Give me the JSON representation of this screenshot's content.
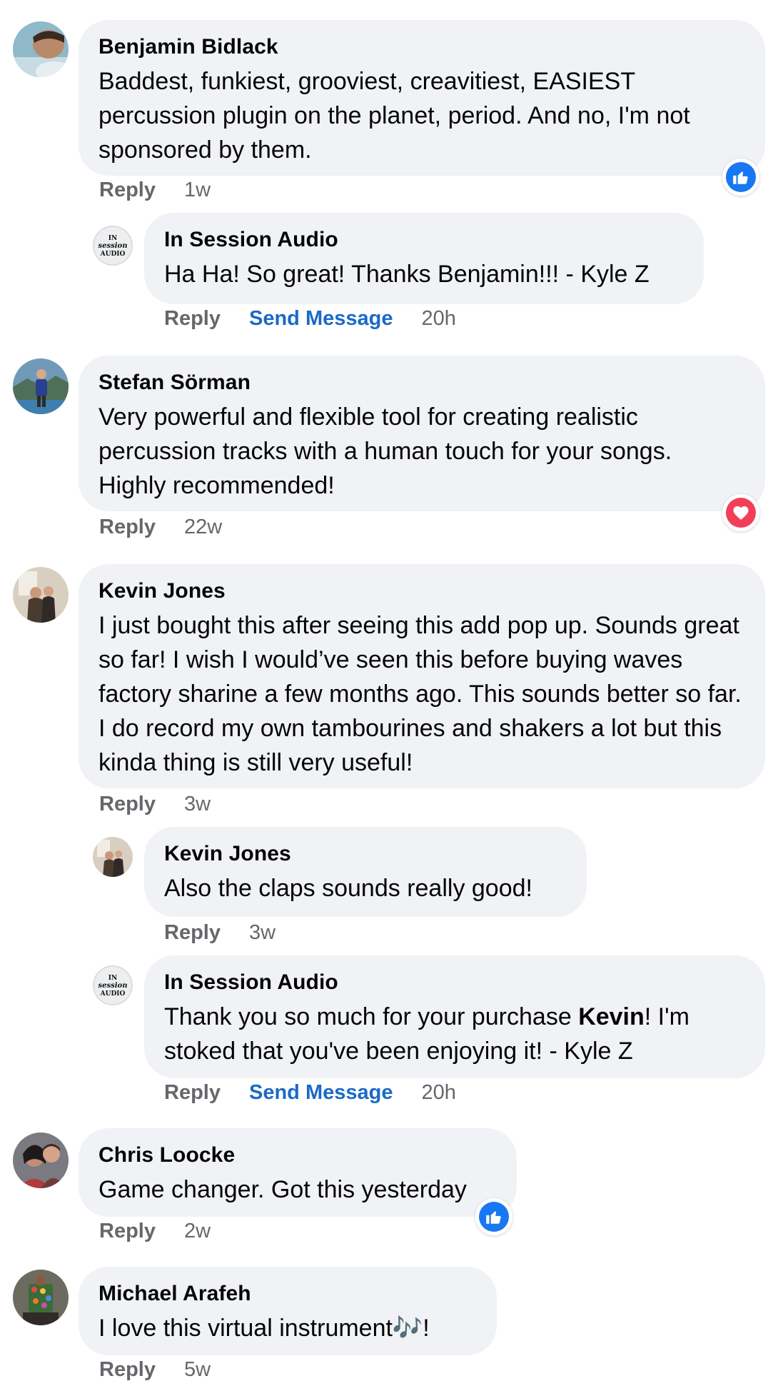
{
  "comments": {
    "c1": {
      "author": "Benjamin Bidlack",
      "text": "Baddest, funkiest, grooviest, creavitiest, EASIEST percussion plugin on the planet, period. And no, I'm not sponsored by them.",
      "reply_label": "Reply",
      "time": "1w",
      "reaction": "like-icon"
    },
    "r1": {
      "author": "In Session Audio",
      "text": "Ha Ha! So great! Thanks Benjamin!!! - Kyle Z",
      "reply_label": "Reply",
      "send_message_label": "Send Message",
      "time": "20h"
    },
    "c2": {
      "author": "Stefan Sörman",
      "text": "Very powerful and flexible tool for creating realistic percussion tracks with a human touch for your songs. Highly recommended!",
      "reply_label": "Reply",
      "time": "22w",
      "reaction": "love-icon"
    },
    "c3": {
      "author": "Kevin Jones",
      "text": "I just bought this after seeing this add pop up. Sounds great so far! I wish I would’ve seen this before buying waves factory sharine a few months ago. This sounds better so far. I do record my own tambourines and shakers a lot but this kinda thing is still very useful!",
      "reply_label": "Reply",
      "time": "3w"
    },
    "r2": {
      "author": "Kevin Jones",
      "text": "Also the claps sounds really good!",
      "reply_label": "Reply",
      "time": "3w"
    },
    "r3": {
      "author": "In Session Audio",
      "text_before": "Thank you so much for your purchase ",
      "text_bold": "Kevin",
      "text_after": "! I'm stoked that you've been enjoying it! - Kyle Z",
      "reply_label": "Reply",
      "send_message_label": "Send Message",
      "time": "20h"
    },
    "c4": {
      "author": "Chris Loocke",
      "text": "Game changer. Got this yesterday",
      "reply_label": "Reply",
      "time": "2w",
      "reaction": "like-icon"
    },
    "c5": {
      "author": "Michael Arafeh",
      "text": "I love this virtual instrument🎶!",
      "reply_label": "Reply",
      "time": "5w"
    }
  },
  "brand_logo_text": "In Session Audio",
  "colors": {
    "bubble": "#f0f2f5",
    "link": "#1b6ac7",
    "meta": "#65676b",
    "like": "#1877f2",
    "love": "#f33e58"
  }
}
